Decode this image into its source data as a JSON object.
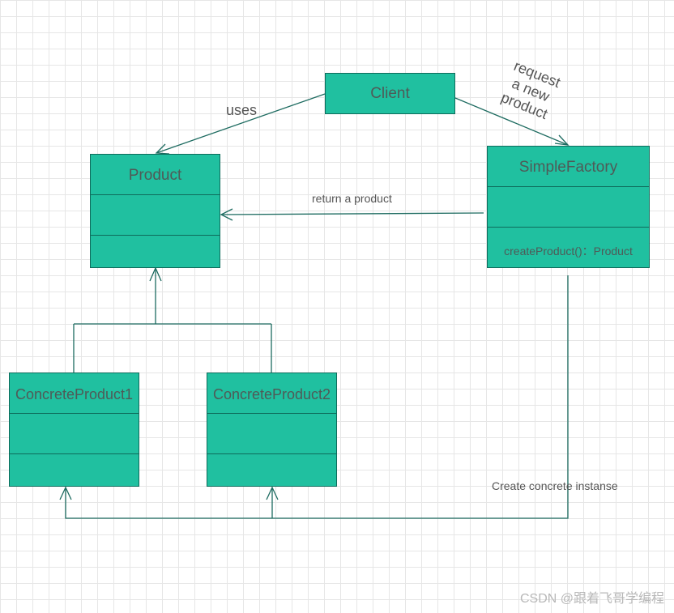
{
  "classes": {
    "client": {
      "name": "Client"
    },
    "product": {
      "name": "Product"
    },
    "factory": {
      "name": "SimpleFactory",
      "method": "createProduct()：Product"
    },
    "concrete1": {
      "name": "ConcreteProduct1"
    },
    "concrete2": {
      "name": "ConcreteProduct2"
    }
  },
  "labels": {
    "uses": "uses",
    "request_line1": "request",
    "request_line2": "a new",
    "request_line3": "product",
    "return_product": "return a product",
    "create_instance": "Create concrete instanse"
  },
  "watermark": "CSDN @跟着飞哥学编程",
  "colors": {
    "box_fill": "#20c0a0",
    "box_border": "#0e6b5b",
    "line": "#1d6b60",
    "grid": "#e6e6e6"
  }
}
